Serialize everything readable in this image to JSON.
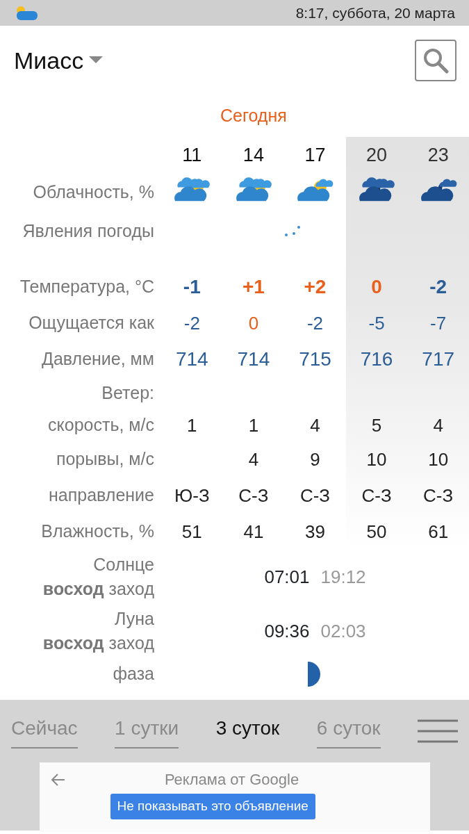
{
  "status_bar": {
    "time": "8:17, суббота, 20 марта"
  },
  "header": {
    "city": "Миасс"
  },
  "day_label": "Сегодня",
  "labels": {
    "clouds": "Облачность, %",
    "phenomena": "Явления погоды",
    "temperature": "Температура, °С",
    "feels": "Ощущается как",
    "pressure": "Давление, мм",
    "wind": "Ветер:",
    "wind_speed": "скорость, м/с",
    "gusts": "порывы, м/с",
    "direction": "направление",
    "humidity": "Влажность, %"
  },
  "hours": [
    {
      "hour": "11",
      "night": false,
      "kind": "cloudy",
      "temp": {
        "text": "-1",
        "color": "#2b5d97"
      },
      "feels": {
        "text": "-2",
        "color": "#2b5d97"
      },
      "pressure": "714",
      "wind_speed": "1",
      "direction": "Ю-З",
      "humidity": "51"
    },
    {
      "hour": "14",
      "night": false,
      "kind": "cloudy",
      "temp": {
        "text": "+1",
        "color": "#e8601c"
      },
      "feels": {
        "text": "0",
        "color": "#e8601c"
      },
      "pressure": "714",
      "wind_speed": "1",
      "gusts": "4",
      "direction": "С-З",
      "humidity": "41"
    },
    {
      "hour": "17",
      "night": false,
      "kind": "partly",
      "snow": true,
      "temp": {
        "text": "+2",
        "color": "#e8601c"
      },
      "feels": {
        "text": "-2",
        "color": "#2b5d97"
      },
      "pressure": "715",
      "wind_speed": "4",
      "gusts": "9",
      "direction": "С-З",
      "humidity": "39"
    },
    {
      "hour": "20",
      "night": true,
      "kind": "cloudy",
      "temp": {
        "text": "0",
        "color": "#e8601c"
      },
      "feels": {
        "text": "-5",
        "color": "#2b5d97"
      },
      "pressure": "716",
      "wind_speed": "5",
      "gusts": "10",
      "direction": "С-З",
      "humidity": "50"
    },
    {
      "hour": "23",
      "night": true,
      "kind": "partly",
      "temp": {
        "text": "-2",
        "color": "#2b5d97"
      },
      "feels": {
        "text": "-7",
        "color": "#2b5d97"
      },
      "pressure": "717",
      "wind_speed": "4",
      "gusts": "10",
      "direction": "С-З",
      "humidity": "61"
    }
  ],
  "sun": {
    "label": "Солнце",
    "sublabel": "**восход** заход",
    "rise": "07:01",
    "set": "19:12"
  },
  "moon": {
    "label": "Луна",
    "sublabel": "**восход** заход",
    "rise": "09:36",
    "set": "02:03",
    "phase_label": "фаза"
  },
  "tabs": [
    {
      "label": "Сейчас",
      "selected": false
    },
    {
      "label": "1 сутки",
      "selected": false
    },
    {
      "label": "3 суток",
      "selected": true
    },
    {
      "label": "6 суток",
      "selected": false
    }
  ],
  "ad": {
    "title": "Реклама от Google",
    "button": "Не показывать это объявление"
  }
}
